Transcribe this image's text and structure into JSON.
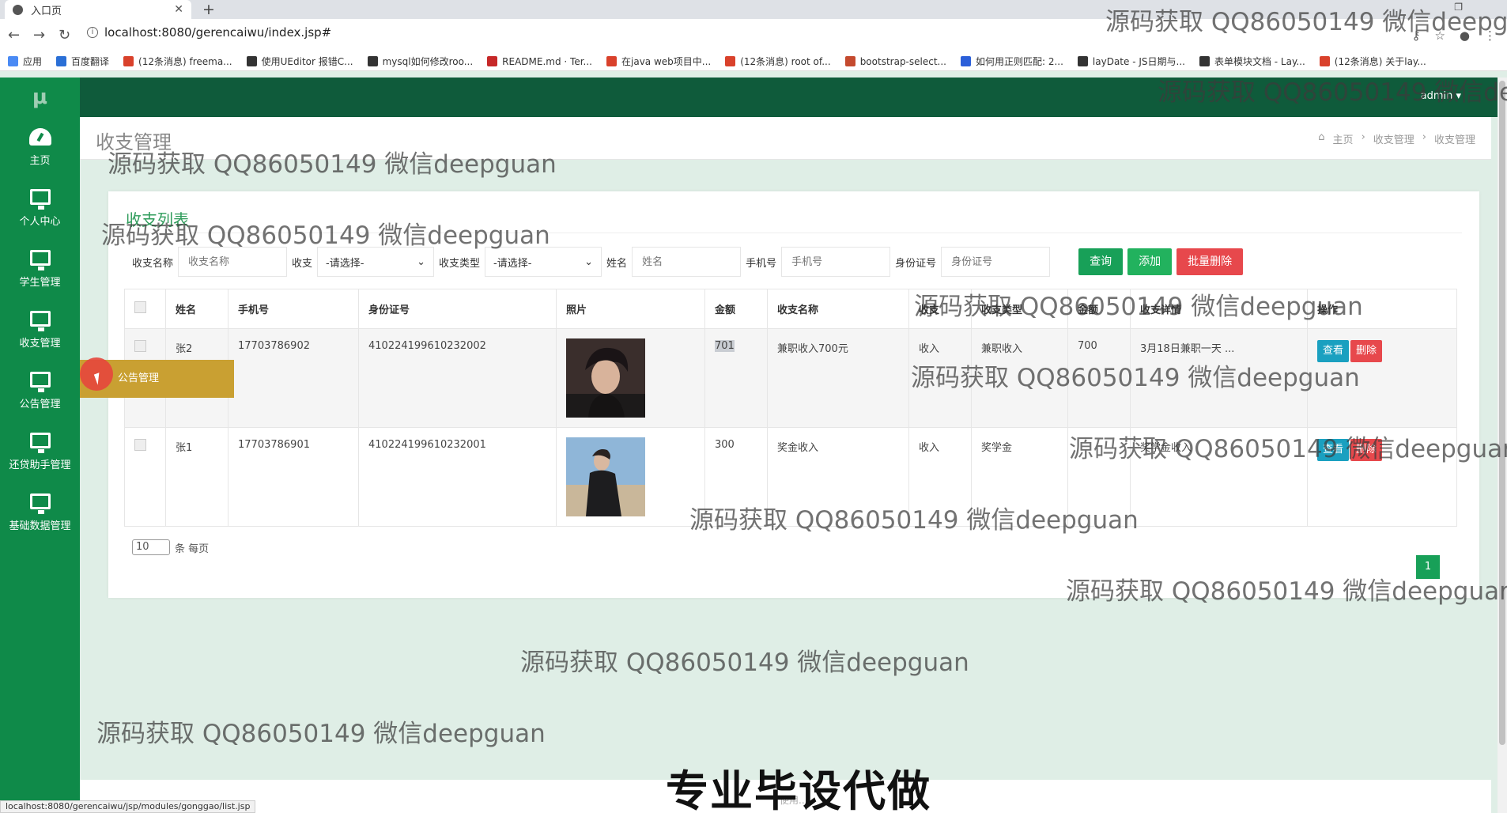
{
  "browser": {
    "tab_title": "入口页",
    "url": "localhost:8080/gerencaiwu/index.jsp#",
    "bookmarks": [
      "应用",
      "百度翻译",
      "(12条消息) freema...",
      "使用UEditor 报错C...",
      "mysql如何修改roo...",
      "README.md · Ter...",
      "在java web项目中...",
      "(12条消息) root of...",
      "bootstrap-select...",
      "如何用正则匹配: 2...",
      "layDate - JS日期与...",
      "表单模块文档 - Lay...",
      "(12条消息) 关于lay..."
    ],
    "bookmark_colors": [
      "#4a8af4",
      "#2a6fd6",
      "#d9412b",
      "#333333",
      "#333333",
      "#c62828",
      "#d9412b",
      "#d9412b",
      "#c44a2e",
      "#2b5fd9",
      "#333333",
      "#333333",
      "#d9412b"
    ],
    "status_url": "localhost:8080/gerencaiwu/jsp/modules/gonggao/list.jsp"
  },
  "sidebar": {
    "logo": "μ",
    "items": [
      {
        "label": "主页",
        "icon": "dashboard-icon"
      },
      {
        "label": "个人中心",
        "icon": "monitor-icon"
      },
      {
        "label": "学生管理",
        "icon": "monitor-icon"
      },
      {
        "label": "收支管理",
        "icon": "monitor-icon"
      },
      {
        "label": "公告管理",
        "icon": "monitor-icon"
      },
      {
        "label": "还贷助手管理",
        "icon": "monitor-icon"
      },
      {
        "label": "基础数据管理",
        "icon": "monitor-icon"
      }
    ]
  },
  "topbar": {
    "user": "admin ▾"
  },
  "header": {
    "title": "收支管理",
    "breadcrumb": [
      "主页",
      "收支管理",
      "收支管理"
    ]
  },
  "card": {
    "title": "收支列表"
  },
  "search": {
    "name_label": "收支名称",
    "name_placeholder": "收支名称",
    "inout_label": "收支",
    "inout_value": "-请选择-",
    "type_label": "收支类型",
    "type_value": "-请选择-",
    "person_label": "姓名",
    "person_placeholder": "姓名",
    "phone_label": "手机号",
    "phone_placeholder": "手机号",
    "id_label": "身份证号",
    "id_placeholder": "身份证号",
    "query_btn": "查询",
    "add_btn": "添加",
    "batch_delete_btn": "批量删除"
  },
  "table": {
    "headers": [
      "姓名",
      "手机号",
      "身份证号",
      "照片",
      "金额",
      "收支名称",
      "收支",
      "收支类型",
      "金额",
      "收支详情",
      "操作"
    ],
    "rows": [
      {
        "name": "张2",
        "phone": "17703786902",
        "id_card": "410224199610232002",
        "amount": "701",
        "title": "兼职收入700元",
        "inout": "收入",
        "type": "兼职收入",
        "amount2": "700",
        "detail": "3月18日兼职一天 ..."
      },
      {
        "name": "张1",
        "phone": "17703786901",
        "id_card": "410224199610232001",
        "amount": "300",
        "title": "奖金收入",
        "inout": "收入",
        "type": "奖学金",
        "amount2": "",
        "detail": "奖学金收入"
      }
    ],
    "view_btn": "查看",
    "delete_btn": "删除"
  },
  "pager": {
    "page_size": "10",
    "per_page_text": "条 每页",
    "current_page": "1"
  },
  "hover_menu": {
    "label": "公告管理"
  },
  "overlay": {
    "watermark": "源码获取 QQ86050149 微信deepguan",
    "promo": "专业毕设代做",
    "footer": "使用..."
  }
}
